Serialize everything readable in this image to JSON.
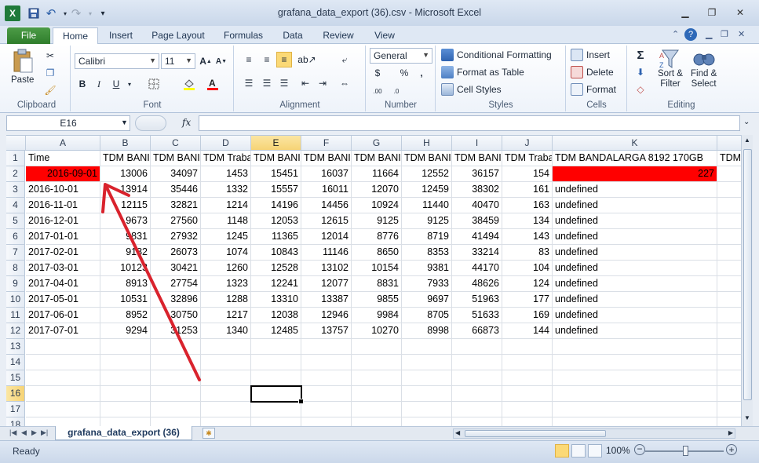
{
  "window": {
    "title": "grafana_data_export (36).csv - Microsoft Excel"
  },
  "ribbon_tabs": [
    "File",
    "Home",
    "Insert",
    "Page Layout",
    "Formulas",
    "Data",
    "Review",
    "View"
  ],
  "ribbon": {
    "clipboard": {
      "paste": "Paste",
      "label": "Clipboard"
    },
    "font": {
      "name": "Calibri",
      "size": "11",
      "label": "Font",
      "bold": "B",
      "italic": "I",
      "underline": "U"
    },
    "alignment": {
      "label": "Alignment"
    },
    "number": {
      "format": "General",
      "percent": "%",
      "comma": ",",
      "label": "Number"
    },
    "styles": {
      "conditional": "Conditional Formatting",
      "format_table": "Format as Table",
      "cell_styles": "Cell Styles",
      "label": "Styles"
    },
    "cells": {
      "insert": "Insert",
      "delete": "Delete",
      "format": "Format",
      "label": "Cells"
    },
    "editing": {
      "sigma": "Σ",
      "sort": "Sort &",
      "sort2": "Filter",
      "find": "Find &",
      "find2": "Select",
      "label": "Editing"
    }
  },
  "formula_bar": {
    "name_box": "E16",
    "fx": "fx",
    "content": ""
  },
  "columns": [
    "A",
    "B",
    "C",
    "D",
    "E",
    "F",
    "G",
    "H",
    "I",
    "J",
    "K"
  ],
  "selected_column": "E",
  "selected_row": "16",
  "rows": [
    [
      "Time",
      "TDM BANI",
      "TDM BANI",
      "TDM Traba",
      "TDM BANI",
      "TDM BANI",
      "TDM BANI",
      "TDM BANI",
      "TDM BANI",
      "TDM Traba",
      "TDM BANDALARGA 8192 170GB",
      "TDM"
    ],
    [
      "2016-09-01",
      "13006",
      "34097",
      "1453",
      "15451",
      "16037",
      "11664",
      "12552",
      "36157",
      "154",
      "227",
      ""
    ],
    [
      "2016-10-01",
      "13914",
      "35446",
      "1332",
      "15557",
      "16011",
      "12070",
      "12459",
      "38302",
      "161",
      "undefined",
      ""
    ],
    [
      "2016-11-01",
      "12115",
      "32821",
      "1214",
      "14196",
      "14456",
      "10924",
      "11440",
      "40470",
      "163",
      "undefined",
      ""
    ],
    [
      "2016-12-01",
      "9673",
      "27560",
      "1148",
      "12053",
      "12615",
      "9125",
      "9125",
      "38459",
      "134",
      "undefined",
      ""
    ],
    [
      "2017-01-01",
      "9831",
      "27932",
      "1245",
      "11365",
      "12014",
      "8776",
      "8719",
      "41494",
      "143",
      "undefined",
      ""
    ],
    [
      "2017-02-01",
      "9182",
      "26073",
      "1074",
      "10843",
      "11146",
      "8650",
      "8353",
      "33214",
      "83",
      "undefined",
      ""
    ],
    [
      "2017-03-01",
      "10123",
      "30421",
      "1260",
      "12528",
      "13102",
      "10154",
      "9381",
      "44170",
      "104",
      "undefined",
      ""
    ],
    [
      "2017-04-01",
      "8913",
      "27754",
      "1323",
      "12241",
      "12077",
      "8831",
      "7933",
      "48626",
      "124",
      "undefined",
      ""
    ],
    [
      "2017-05-01",
      "10531",
      "32896",
      "1288",
      "13310",
      "13387",
      "9855",
      "9697",
      "51963",
      "177",
      "undefined",
      ""
    ],
    [
      "2017-06-01",
      "8952",
      "30750",
      "1217",
      "12038",
      "12946",
      "9984",
      "8705",
      "51633",
      "169",
      "undefined",
      ""
    ],
    [
      "2017-07-01",
      "9294",
      "31253",
      "1340",
      "12485",
      "13757",
      "10270",
      "8998",
      "66873",
      "144",
      "undefined",
      ""
    ]
  ],
  "row_numbers": [
    "1",
    "2",
    "3",
    "4",
    "5",
    "6",
    "7",
    "8",
    "9",
    "10",
    "11",
    "12",
    "13",
    "14",
    "15",
    "16",
    "17",
    "18"
  ],
  "sheet_tab": "grafana_data_export (36)",
  "status": {
    "text": "Ready",
    "zoom": "100%"
  },
  "colors": {
    "highlight": "#ff0000",
    "arrow": "#d9232d",
    "selected_header": "#f6d375"
  }
}
